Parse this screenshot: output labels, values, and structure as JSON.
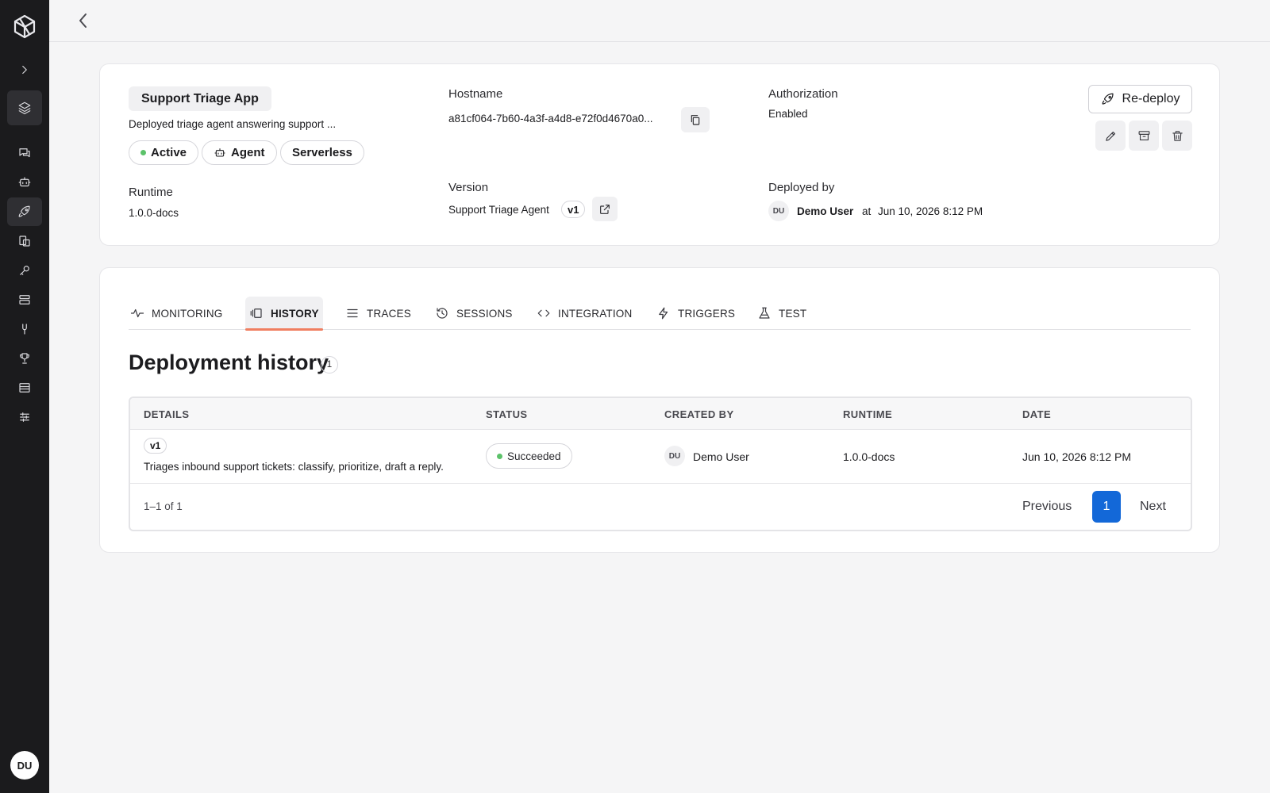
{
  "user": {
    "initials": "DU",
    "name": "Demo User"
  },
  "app": {
    "name": "Support Triage App",
    "description": "Deployed triage agent answering support ...",
    "badges": {
      "status": "Active",
      "type": "Agent",
      "mode": "Serverless"
    },
    "hostname_label": "Hostname",
    "hostname": "a81cf064-7b60-4a3f-a4d8-e72f0d4670a0...",
    "authorization_label": "Authorization",
    "authorization": "Enabled",
    "runtime_label": "Runtime",
    "runtime": "1.0.0-docs",
    "version_label": "Version",
    "version_name": "Support Triage Agent",
    "version": "v1",
    "deployed_by_label": "Deployed by",
    "deployed_by_initials": "DU",
    "deployed_by": "Demo User",
    "deployed_at_prefix": "at",
    "deployed_at": "Jun 10, 2026 8:12 PM",
    "redeploy_label": "Re-deploy"
  },
  "tabs": [
    {
      "label": "MONITORING",
      "icon": "activity-icon"
    },
    {
      "label": "HISTORY",
      "icon": "history-icon",
      "active": true
    },
    {
      "label": "TRACES",
      "icon": "list-icon"
    },
    {
      "label": "SESSIONS",
      "icon": "clock-icon"
    },
    {
      "label": "INTEGRATION",
      "icon": "code-icon"
    },
    {
      "label": "TRIGGERS",
      "icon": "bolt-icon"
    },
    {
      "label": "TEST",
      "icon": "flask-icon"
    }
  ],
  "history": {
    "title": "Deployment history",
    "count": "1",
    "columns": [
      "DETAILS",
      "STATUS",
      "CREATED BY",
      "RUNTIME",
      "DATE"
    ],
    "rows": [
      {
        "version": "v1",
        "details": "Triages inbound support tickets: classify, prioritize, draft a reply.",
        "status": "Succeeded",
        "created_by_initials": "DU",
        "created_by": "Demo User",
        "runtime": "1.0.0-docs",
        "date": "Jun 10, 2026 8:12 PM"
      }
    ],
    "pagination": {
      "range": "1–1 of 1",
      "previous": "Previous",
      "current": "1",
      "next": "Next"
    }
  },
  "colors": {
    "accent": "#f07e60",
    "primary": "#1368d8",
    "success": "#5cc26a",
    "sidebar": "#1b1b1d"
  }
}
